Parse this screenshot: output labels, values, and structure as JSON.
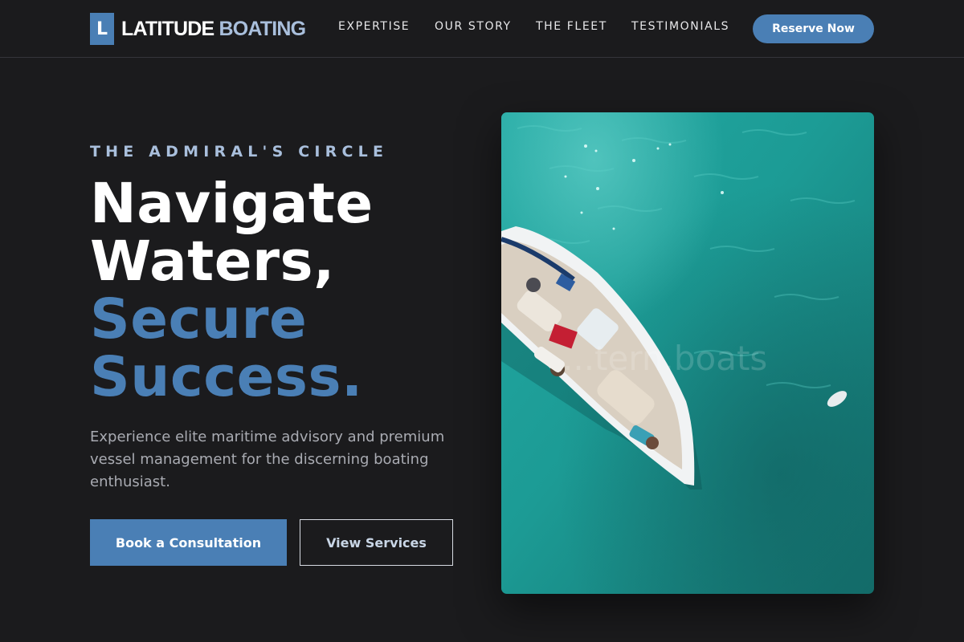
{
  "brand": {
    "mark": "L",
    "name_main": "LATITUDE",
    "name_accent": "BOATING"
  },
  "nav": {
    "links": [
      {
        "label": "EXPERTISE"
      },
      {
        "label": "OUR STORY"
      },
      {
        "label": "THE FLEET"
      },
      {
        "label": "TESTIMONIALS"
      }
    ],
    "cta_label": "Reserve Now"
  },
  "hero": {
    "eyebrow": "THE ADMIRAL'S CIRCLE",
    "headline_line1": "Navigate",
    "headline_line2": "Waters,",
    "headline_line3": "Secure",
    "headline_line4": "Success.",
    "lead": "Experience elite maritime advisory and premium vessel management for the discerning boating enthusiast.",
    "primary_cta": "Book a Consultation",
    "secondary_cta": "View Services",
    "image_watermark": "...tern.boats"
  },
  "colors": {
    "background": "#1b1b1d",
    "accent": "#4a7fb5",
    "accent_light": "#a9bfdc",
    "water": "#1e9e98"
  },
  "icons": {
    "logo": "letter-l-badge"
  }
}
